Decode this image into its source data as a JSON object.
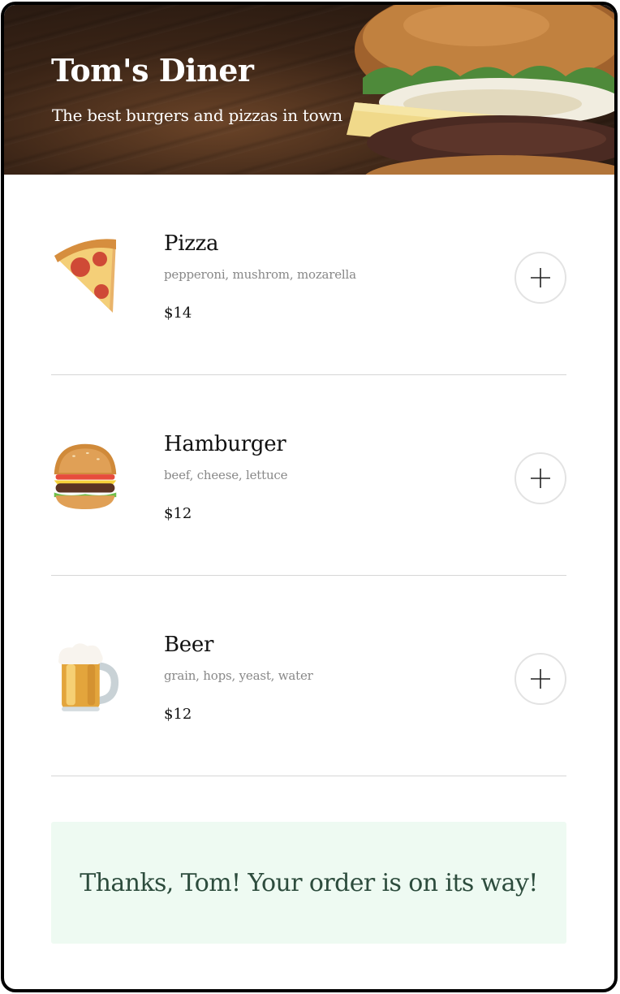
{
  "header": {
    "title": "Tom's Diner",
    "subtitle": "The best burgers and pizzas in town"
  },
  "menu": {
    "items": [
      {
        "name": "Pizza",
        "ingredients": "pepperoni, mushrom, mozarella",
        "price": "$14",
        "icon": "pizza-slice-icon"
      },
      {
        "name": "Hamburger",
        "ingredients": "beef, cheese, lettuce",
        "price": "$12",
        "icon": "hamburger-icon"
      },
      {
        "name": "Beer",
        "ingredients": "grain, hops, yeast, water",
        "price": "$12",
        "icon": "beer-mug-icon"
      }
    ]
  },
  "order": {
    "message": "Thanks, Tom! Your order is on its way!"
  },
  "colors": {
    "order_bg": "#eefaf2",
    "order_text": "#2d4c3d",
    "divider": "#d6d6d6",
    "muted_text": "#888888"
  }
}
